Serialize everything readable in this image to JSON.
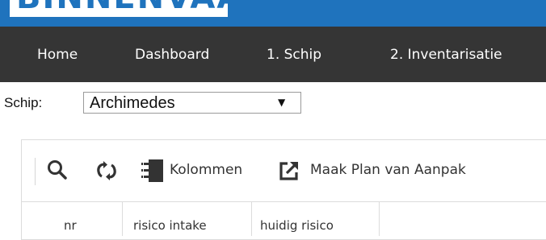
{
  "header": {
    "logo_text": "BINNENVAART"
  },
  "nav": {
    "items": [
      {
        "label": "Home"
      },
      {
        "label": "Dashboard"
      },
      {
        "label": "1. Schip"
      },
      {
        "label": "2. Inventarisatie"
      }
    ]
  },
  "ship_selector": {
    "label": "Schip:",
    "value": "Archimedes",
    "arrow": "▼"
  },
  "toolbar": {
    "icons": [
      "search-icon",
      "refresh-icon",
      "columns-icon",
      "external-link-icon"
    ],
    "columns_label": "Kolommen",
    "plan_label": "Maak Plan van Aanpak"
  },
  "table": {
    "columns": [
      "nr",
      "risico intake",
      "huidig risico",
      ""
    ]
  },
  "colors": {
    "topbar": "#1f73bd",
    "navbar": "#353535",
    "icon": "#333333"
  }
}
